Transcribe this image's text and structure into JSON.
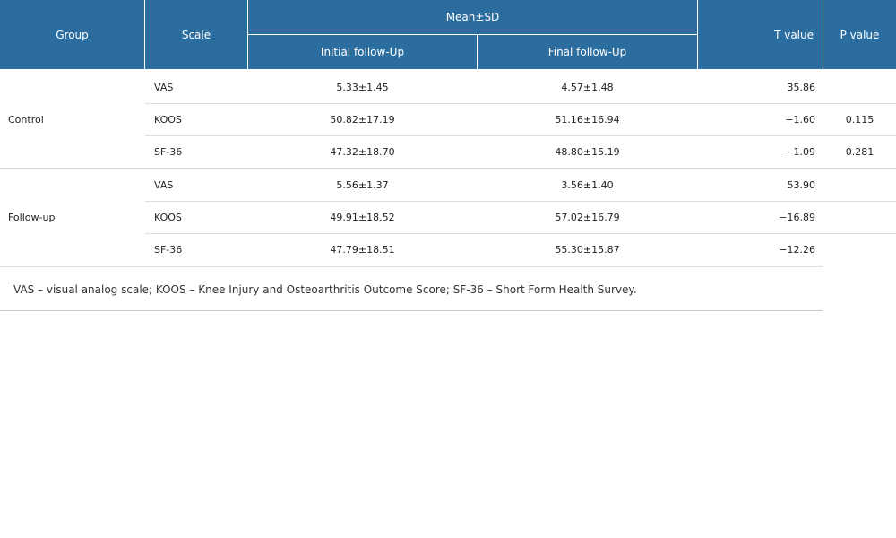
{
  "table": {
    "header": {
      "group": "Group",
      "scale": "Scale",
      "mean_sd": "Mean±SD",
      "initial": "Initial follow-Up",
      "final": "Final follow-Up",
      "t_value": "T value",
      "p_value": "P value"
    },
    "groups": [
      {
        "name": "Control",
        "rows": [
          {
            "scale": "VAS",
            "initial": "5.33±1.45",
            "final": "4.57±1.48",
            "t": "35.86",
            "p": ""
          },
          {
            "scale": "KOOS",
            "initial": "50.82±17.19",
            "final": "51.16±16.94",
            "t": "−1.60",
            "p": "0.115"
          },
          {
            "scale": "SF-36",
            "initial": "47.32±18.70",
            "final": "48.80±15.19",
            "t": "−1.09",
            "p": "0.281"
          }
        ]
      },
      {
        "name": "Follow-up",
        "rows": [
          {
            "scale": "VAS",
            "initial": "5.56±1.37",
            "final": "3.56±1.40",
            "t": "53.90",
            "p": ""
          },
          {
            "scale": "KOOS",
            "initial": "49.91±18.52",
            "final": "57.02±16.79",
            "t": "−16.89",
            "p": ""
          },
          {
            "scale": "SF-36",
            "initial": "47.79±18.51",
            "final": "55.30±15.87",
            "t": "−12.26",
            "p": ""
          }
        ]
      }
    ],
    "footnote": "VAS – visual analog scale; KOOS – Knee Injury and Osteoarthritis Outcome Score; SF-36 – Short Form Health Survey."
  }
}
